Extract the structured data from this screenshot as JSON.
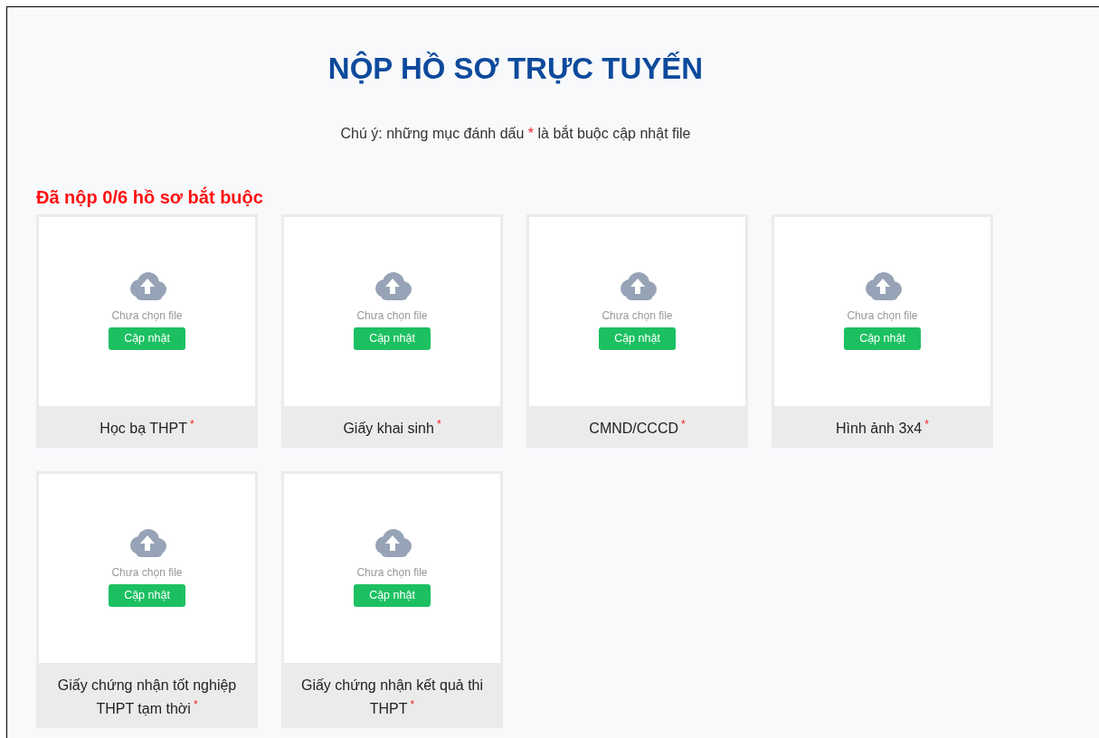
{
  "title": "NỘP HỒ SƠ TRỰC TUYẾN",
  "note": {
    "before": "Chú ý: những mục đánh dấu ",
    "mark": "*",
    "after": " là bắt buộc cập nhật file"
  },
  "submitted_count": "Đã nộp 0/6 hồ sơ bắt buộc",
  "documents": [
    {
      "label": "Học bạ THPT",
      "required": true,
      "mark": "*",
      "status": "Chưa chọn file",
      "button": "Cập nhật"
    },
    {
      "label": "Giấy khai sinh",
      "required": true,
      "mark": "*",
      "status": "Chưa chọn file",
      "button": "Cập nhật"
    },
    {
      "label": "CMND/CCCD",
      "required": true,
      "mark": "*",
      "status": "Chưa chọn file",
      "button": "Cập nhật"
    },
    {
      "label": "Hình ảnh 3x4",
      "required": true,
      "mark": "*",
      "status": "Chưa chọn file",
      "button": "Cập nhật"
    },
    {
      "label": "Giấy chứng nhận tốt nghiệp THPT tạm thời",
      "required": true,
      "mark": "*",
      "status": "Chưa chọn file",
      "button": "Cập nhật"
    },
    {
      "label": "Giấy chứng nhận kết quả thi THPT",
      "required": true,
      "mark": "*",
      "status": "Chưa chọn file",
      "button": "Cập nhật"
    }
  ]
}
